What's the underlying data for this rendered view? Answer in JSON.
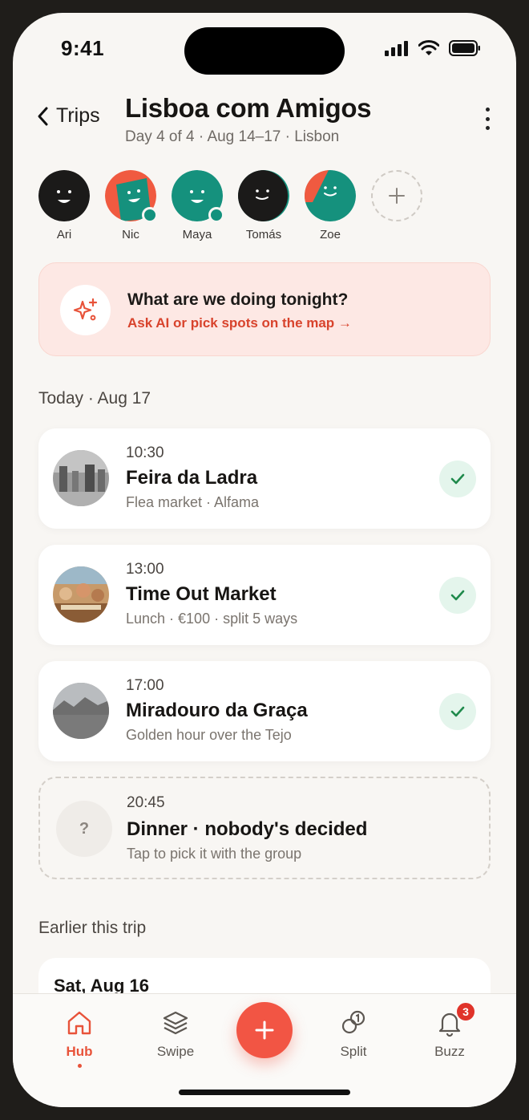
{
  "status": {
    "time": "9:41"
  },
  "header": {
    "back_label": "Trips",
    "title": "Lisboa com Amigos",
    "subtitle": "Day 4 of 4 · Aug 14–17 · Lisbon"
  },
  "members": [
    {
      "name": "Ari"
    },
    {
      "name": "Nic"
    },
    {
      "name": "Maya"
    },
    {
      "name": "Tomás"
    },
    {
      "name": "Zoe"
    }
  ],
  "ai_prompt": {
    "title": "What are we doing tonight?",
    "link": "Ask AI or pick spots on the map →"
  },
  "today": {
    "label": "Today · Aug 17",
    "events": [
      {
        "time": "10:30",
        "name": "Feira da Ladra",
        "meta": "Flea market · Alfama"
      },
      {
        "time": "13:00",
        "name": "Time Out Market",
        "meta": "Lunch · €100 · split 5 ways"
      },
      {
        "time": "17:00",
        "name": "Miradouro da Graça",
        "meta": "Golden hour over the Tejo"
      }
    ],
    "pending": {
      "mark": "?",
      "time": "20:45",
      "name": "Dinner · nobody's decided",
      "meta": "Tap to pick it with the group"
    }
  },
  "earlier": {
    "label": "Earlier this trip",
    "card_title": "Sat, Aug 16"
  },
  "tabs": {
    "hub": "Hub",
    "swipe": "Swipe",
    "split": "Split",
    "buzz": "Buzz",
    "buzz_badge": "3"
  },
  "colors": {
    "accent": "#f25544",
    "teal": "#12917d",
    "link": "#d8432c",
    "ai_card_bg": "#fde8e4",
    "check_bg": "#e4f5ec"
  }
}
